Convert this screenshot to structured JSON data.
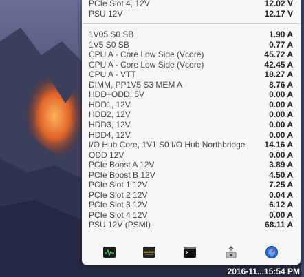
{
  "top_section": [
    {
      "label": "PCIe Slot 4, 12V",
      "value": "12.02 V"
    },
    {
      "label": "PSU 12V",
      "value": "12.17 V"
    }
  ],
  "current_section": [
    {
      "label": "1V05 S0 SB",
      "value": "1.90 A"
    },
    {
      "label": "1V5 S0 SB",
      "value": "0.77 A"
    },
    {
      "label": "CPU A - Core Low Side (Vcore)",
      "value": "45.72 A"
    },
    {
      "label": "CPU A - Core Low Side (Vcore)",
      "value": "42.45 A"
    },
    {
      "label": "CPU A - VTT",
      "value": "18.27 A"
    },
    {
      "label": "DIMM, PP1V5 S3 MEM A",
      "value": "8.76 A"
    },
    {
      "label": "HDD+ODD, 5V",
      "value": "0.00 A"
    },
    {
      "label": "HDD1, 12V",
      "value": "0.00 A"
    },
    {
      "label": "HDD2, 12V",
      "value": "0.00 A"
    },
    {
      "label": "HDD3, 12V",
      "value": "0.00 A"
    },
    {
      "label": "HDD4, 12V",
      "value": "0.00 A"
    },
    {
      "label": "I/O Hub Core, 1V1 S0 I/O Hub Northbridge",
      "value": "14.16 A"
    },
    {
      "label": "ODD 12V",
      "value": "0.00 A"
    },
    {
      "label": "PCIe Boost A 12V",
      "value": "3.89 A"
    },
    {
      "label": "PCIe Boost B 12V",
      "value": "4.50 A"
    },
    {
      "label": "PCIe Slot 1 12V",
      "value": "7.25 A"
    },
    {
      "label": "PCIe Slot 2 12V",
      "value": "0.04 A"
    },
    {
      "label": "PCIe Slot 3 12V",
      "value": "6.12 A"
    },
    {
      "label": "PCIe Slot 4 12V",
      "value": "0.00 A"
    },
    {
      "label": "PSU 12V (PSMI)",
      "value": "68.11 A"
    }
  ],
  "toolbar": {
    "buttons": [
      {
        "name": "activity-monitor-icon"
      },
      {
        "name": "console-icon"
      },
      {
        "name": "terminal-icon"
      },
      {
        "name": "system-information-icon"
      },
      {
        "name": "network-utility-icon"
      }
    ],
    "console_text": "WARNIN"
  },
  "menubar": {
    "clock": "2016-11...15:54 PM"
  },
  "colors": {
    "panel_bg": "#f6f6f6",
    "value_text": "#1f1f1f"
  }
}
